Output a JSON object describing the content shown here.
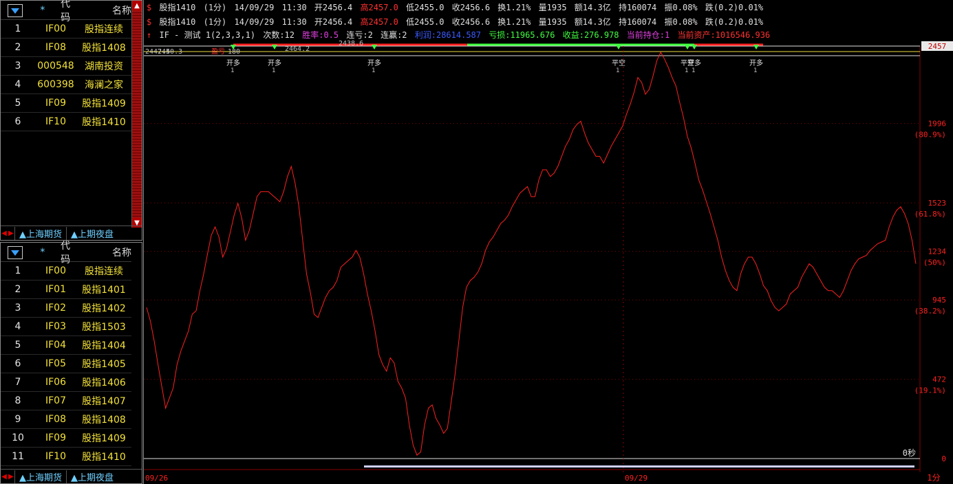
{
  "watchlist_top": {
    "header": {
      "star": "*",
      "code": "代码",
      "name": "名称"
    },
    "rows": [
      {
        "idx": "1",
        "code": "IF00",
        "name": "股指连续"
      },
      {
        "idx": "2",
        "code": "IF08",
        "name": "股指1408"
      },
      {
        "idx": "3",
        "code": "000548",
        "name": "湖南投资"
      },
      {
        "idx": "4",
        "code": "600398",
        "name": "海澜之家"
      },
      {
        "idx": "5",
        "code": "IF09",
        "name": "股指1409"
      },
      {
        "idx": "6",
        "code": "IF10",
        "name": "股指1410"
      }
    ],
    "tabs": [
      "上海期货",
      "上期夜盘"
    ]
  },
  "watchlist_bottom": {
    "header": {
      "star": "*",
      "code": "代码",
      "name": "名称"
    },
    "rows": [
      {
        "idx": "1",
        "code": "IF00",
        "name": "股指连续"
      },
      {
        "idx": "2",
        "code": "IF01",
        "name": "股指1401"
      },
      {
        "idx": "3",
        "code": "IF02",
        "name": "股指1402"
      },
      {
        "idx": "4",
        "code": "IF03",
        "name": "股指1503"
      },
      {
        "idx": "5",
        "code": "IF04",
        "name": "股指1404"
      },
      {
        "idx": "6",
        "code": "IF05",
        "name": "股指1405"
      },
      {
        "idx": "7",
        "code": "IF06",
        "name": "股指1406"
      },
      {
        "idx": "8",
        "code": "IF07",
        "name": "股指1407"
      },
      {
        "idx": "9",
        "code": "IF08",
        "name": "股指1408"
      },
      {
        "idx": "10",
        "code": "IF09",
        "name": "股指1409"
      },
      {
        "idx": "11",
        "code": "IF10",
        "name": "股指1410"
      }
    ],
    "tabs": [
      "上海期货",
      "上期夜盘"
    ]
  },
  "quote": {
    "symbol": "股指1410",
    "period": "(1分)",
    "date": "14/09/29",
    "time": "11:30",
    "open": "开2456.4",
    "high": "高2457.0",
    "low": "低2455.0",
    "close": "收2456.6",
    "turnover": "换1.21%",
    "volume": "量1935",
    "amount": "额14.3亿",
    "oi": "持160074",
    "amplitude": "振0.08%",
    "change": "跌(0.2)0.01%"
  },
  "strategy": {
    "name": "IF - 测试 1(2,3,3,1)",
    "trades": "次数:12",
    "winrate": "胜率:0.5",
    "loss_streak": "连亏:2",
    "win_streak": "连赢:2",
    "profit": "利润:28614.587",
    "loss": "亏损:11965.676",
    "net": "收益:276.978",
    "position": "当前持仓:1",
    "assets": "当前资产:1016546.936"
  },
  "chart_data": {
    "type": "line",
    "series": [
      {
        "values": [
          900,
          820,
          700,
          560,
          430,
          300,
          360,
          420,
          560,
          640,
          700,
          760,
          860,
          880,
          1000,
          1100,
          1220,
          1330,
          1380,
          1320,
          1200,
          1250,
          1350,
          1450,
          1520,
          1430,
          1300,
          1360,
          1460,
          1560,
          1590,
          1590,
          1590,
          1570,
          1550,
          1530,
          1590,
          1680,
          1740,
          1640,
          1500,
          1300,
          1100,
          990,
          860,
          840,
          900,
          960,
          1000,
          1020,
          1060,
          1140,
          1160,
          1180,
          1200,
          1240,
          1200,
          1100,
          980,
          880,
          760,
          620,
          560,
          520,
          600,
          570,
          460,
          420,
          360,
          200,
          80,
          20,
          40,
          200,
          300,
          320,
          240,
          200,
          150,
          180,
          340,
          500,
          700,
          900,
          1020,
          1060,
          1080,
          1110,
          1160,
          1240,
          1290,
          1320,
          1360,
          1400,
          1420,
          1450,
          1500,
          1540,
          1580,
          1600,
          1620,
          1560,
          1560,
          1660,
          1720,
          1720,
          1680,
          1700,
          1740,
          1800,
          1860,
          1900,
          1960,
          1990,
          2010,
          1940,
          1880,
          1840,
          1800,
          1800,
          1760,
          1810,
          1860,
          1900,
          1940,
          1980,
          2050,
          2110,
          2180,
          2270,
          2240,
          2170,
          2200,
          2280,
          2370,
          2420,
          2380,
          2330,
          2270,
          2220,
          2120,
          2030,
          1920,
          1850,
          1760,
          1660,
          1600,
          1530,
          1460,
          1380,
          1300,
          1200,
          1120,
          1060,
          1020,
          1000,
          1100,
          1160,
          1200,
          1200,
          1160,
          1100,
          1030,
          1000,
          940,
          900,
          880,
          900,
          920,
          980,
          1000,
          1020,
          1080,
          1120,
          1160,
          1140,
          1100,
          1060,
          1020,
          1000,
          1000,
          980,
          960,
          1000,
          1060,
          1120,
          1160,
          1190,
          1200,
          1210,
          1240,
          1260,
          1280,
          1290,
          1300,
          1380,
          1440,
          1480,
          1500,
          1460,
          1400,
          1300,
          1160
        ]
      }
    ],
    "yticks": [
      {
        "value": "2457",
        "pct": ""
      },
      {
        "value": "1996",
        "pct": "(80.9%)"
      },
      {
        "value": "1523",
        "pct": "(61.8%)"
      },
      {
        "value": "1234",
        "pct": "(50%)"
      },
      {
        "value": "945",
        "pct": "(38.2%)"
      },
      {
        "value": "472",
        "pct": "(19.1%)"
      },
      {
        "value": "0",
        "pct": ""
      }
    ],
    "xticks": [
      "09/26",
      "09/29"
    ],
    "period_label": "1分",
    "countdown": "0秒",
    "markers": [
      "开多",
      "开多",
      "开多",
      "平空",
      "平空",
      "开多",
      "开多"
    ],
    "marker_counts": [
      "1",
      "1",
      "1",
      "1",
      "1",
      "1",
      "1"
    ],
    "overlay_labels": [
      "2447.4",
      "2450.3",
      "2464.2",
      "2438.6",
      "盈亏",
      "180"
    ],
    "ylim": [
      0,
      2457
    ],
    "colors": {
      "line": "#ff2020",
      "grid": "#8b0000",
      "axis_text": "#ff2020"
    }
  }
}
